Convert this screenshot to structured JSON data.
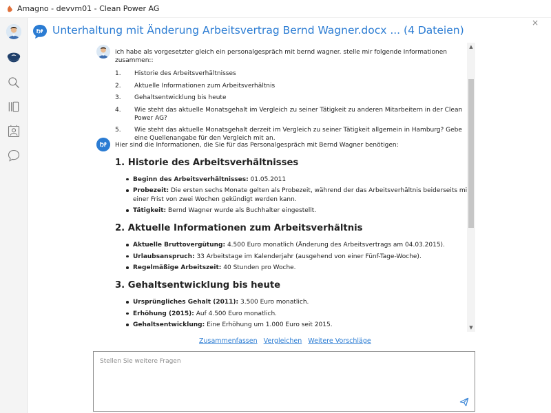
{
  "window": {
    "title": "Amagno - devvm01 - Clean Power AG",
    "close_glyph": "×"
  },
  "colors": {
    "accent": "#2b7cd3",
    "sidebar_bg": "#f4f4f4",
    "text": "#222222"
  },
  "sidebar": {
    "items": [
      {
        "name": "avatar"
      },
      {
        "name": "logo-icon"
      },
      {
        "name": "search-icon"
      },
      {
        "name": "library-icon"
      },
      {
        "name": "contact-icon"
      },
      {
        "name": "chat-icon"
      }
    ]
  },
  "header": {
    "title": "Unterhaltung mit Änderung Arbeitsvertrag Bernd Wagner.docx ... (4 Dateien)"
  },
  "user_message": {
    "intro": "ich habe als vorgesetzter gleich ein personalgespräch mit bernd wagner. stelle mir folgende Informationen zusammen::",
    "items": [
      "Historie des Arbeitsverhältnisses",
      "Aktuelle Informationen zum Arbeitsverhältnis",
      "Gehaltsentwicklung bis heute",
      "Wie steht das aktuelle Monatsgehalt im Vergleich zu seiner Tätigkeit zu anderen Mitarbeitern in der Clean Power AG?",
      "Wie steht das aktuelle Monatsgehalt derzeit im Vergleich zu seiner Tätigkeit allgemein in Hamburg? Gebe eine Quellenangabe für den Vergleich mit an."
    ]
  },
  "ai_message": {
    "intro": "Hier sind die Informationen, die Sie für das Personalgespräch mit Bernd Wagner benötigen:",
    "sections": [
      {
        "heading": "1. Historie des Arbeitsverhältnisses",
        "bullets": [
          {
            "label": "Beginn des Arbeitsverhältnisses:",
            "text": " 01.05.2011"
          },
          {
            "label": "Probezeit:",
            "text": " Die ersten sechs Monate gelten als Probezeit, während der das Arbeitsverhältnis beiderseits mit einer Frist von zwei Wochen gekündigt werden kann."
          },
          {
            "label": "Tätigkeit:",
            "text": " Bernd Wagner wurde als Buchhalter eingestellt."
          }
        ]
      },
      {
        "heading": "2. Aktuelle Informationen zum Arbeitsverhältnis",
        "bullets": [
          {
            "label": "Aktuelle Bruttovergütung:",
            "text": " 4.500 Euro monatlich (Änderung des Arbeitsvertrags am 04.03.2015)."
          },
          {
            "label": "Urlaubsanspruch:",
            "text": " 33 Arbeitstage im Kalenderjahr (ausgehend von einer Fünf-Tage-Woche)."
          },
          {
            "label": "Regelmäßige Arbeitszeit:",
            "text": " 40 Stunden pro Woche."
          }
        ]
      },
      {
        "heading": "3. Gehaltsentwicklung bis heute",
        "bullets": [
          {
            "label": "Ursprüngliches Gehalt (2011):",
            "text": " 3.500 Euro monatlich."
          },
          {
            "label": "Erhöhung (2015):",
            "text": " Auf 4.500 Euro monatlich."
          },
          {
            "label": "Gehaltsentwicklung:",
            "text": " Eine Erhöhung um 1.000 Euro seit 2015."
          }
        ]
      }
    ]
  },
  "suggestions": [
    "Zusammenfassen",
    "Vergleichen",
    "Weitere Vorschläge"
  ],
  "input": {
    "placeholder": "Stellen Sie weitere Fragen",
    "value": ""
  }
}
